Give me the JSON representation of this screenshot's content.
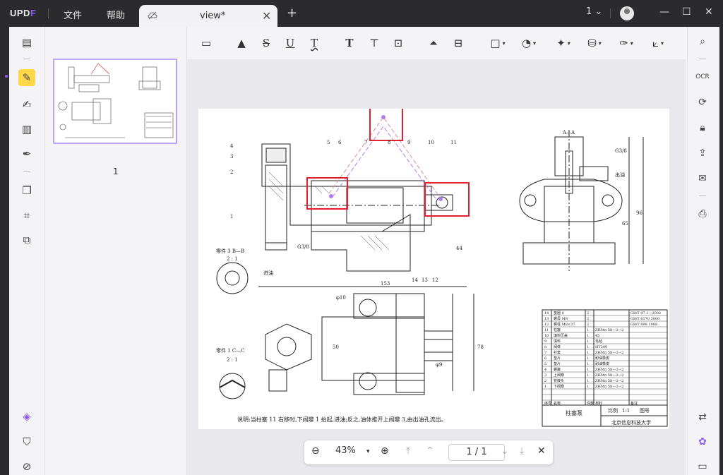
{
  "app": {
    "logo": "UPDF",
    "menu": [
      "文件",
      "帮助"
    ],
    "tab": {
      "name": "view*"
    },
    "page_indicator": "1"
  },
  "drawing": {
    "caption": "说明:当柱塞 11 右移时,下阀瓣 1 抬起,进油;反之,油体推开上阀瓣 3,由出油孔流出。",
    "labels": {
      "aa": "A—A",
      "section_b": "零件 3  B—B",
      "section_c": "零件 1  C—C",
      "scale": "2 : 1",
      "g38": "G3/8",
      "inlet": "进油",
      "outlet": "出油",
      "dim153": "153",
      "dimPhi10": "φ10",
      "dimPhi9": "φ9",
      "dim96": "96",
      "dim65": "65",
      "dim44": "44",
      "dim50": "50",
      "dim78": "78",
      "title_block": "柱塞泵",
      "school": "北京信息科技大学"
    },
    "callouts": [
      "4",
      "3",
      "2",
      "1",
      "5",
      "6",
      "7",
      "8",
      "9",
      "10",
      "11",
      "14",
      "13",
      "12"
    ],
    "bom": [
      [
        "14",
        "垫圈 8",
        "2",
        "",
        "GB/T 97.1—2002"
      ],
      [
        "13",
        "螺母 M8",
        "2",
        "",
        "GB/T 6170  2000"
      ],
      [
        "12",
        "螺柱 M8×37",
        "2",
        "",
        "GB/T 898  1988"
      ],
      [
        "11",
        "柱塞",
        "1",
        "ZHMn 58—2—2",
        ""
      ],
      [
        "10",
        "填料压盖",
        "1",
        "45",
        ""
      ],
      [
        "9",
        "填料",
        "1",
        "毛毡",
        ""
      ],
      [
        "8",
        "阀体",
        "1",
        "HT200",
        ""
      ],
      [
        "7",
        "衬套",
        "1",
        "ZHMn 58—2—2",
        ""
      ],
      [
        "6",
        "垫片",
        "1",
        "耐油橡皮",
        ""
      ],
      [
        "5",
        "垫片",
        "1",
        "耐油橡皮",
        ""
      ],
      [
        "4",
        "螺塞",
        "1",
        "ZHMn 58—2—2",
        ""
      ],
      [
        "3",
        "上阀瓣",
        "1",
        "ZHMn 58—2—2",
        ""
      ],
      [
        "2",
        "管接头",
        "1",
        "ZHMn 58—2—2",
        ""
      ],
      [
        "1",
        "下阀瓣",
        "1",
        "ZHMn 58—2—2",
        ""
      ]
    ],
    "bom_header": [
      "序号",
      "名称",
      "件数",
      "材料",
      "备注"
    ],
    "title_meta": {
      "scale_label": "比例",
      "scale_value": "1:1",
      "drawing_label": "图号"
    }
  },
  "zoom": {
    "value": "43%",
    "page": "1 / 1"
  },
  "thumb_page": "1",
  "colors": {
    "accent": "#8b5cf6",
    "highlight": "#ffd84a",
    "annotation_red": "#e0202a",
    "annotation_purple": "#b07cf0"
  }
}
